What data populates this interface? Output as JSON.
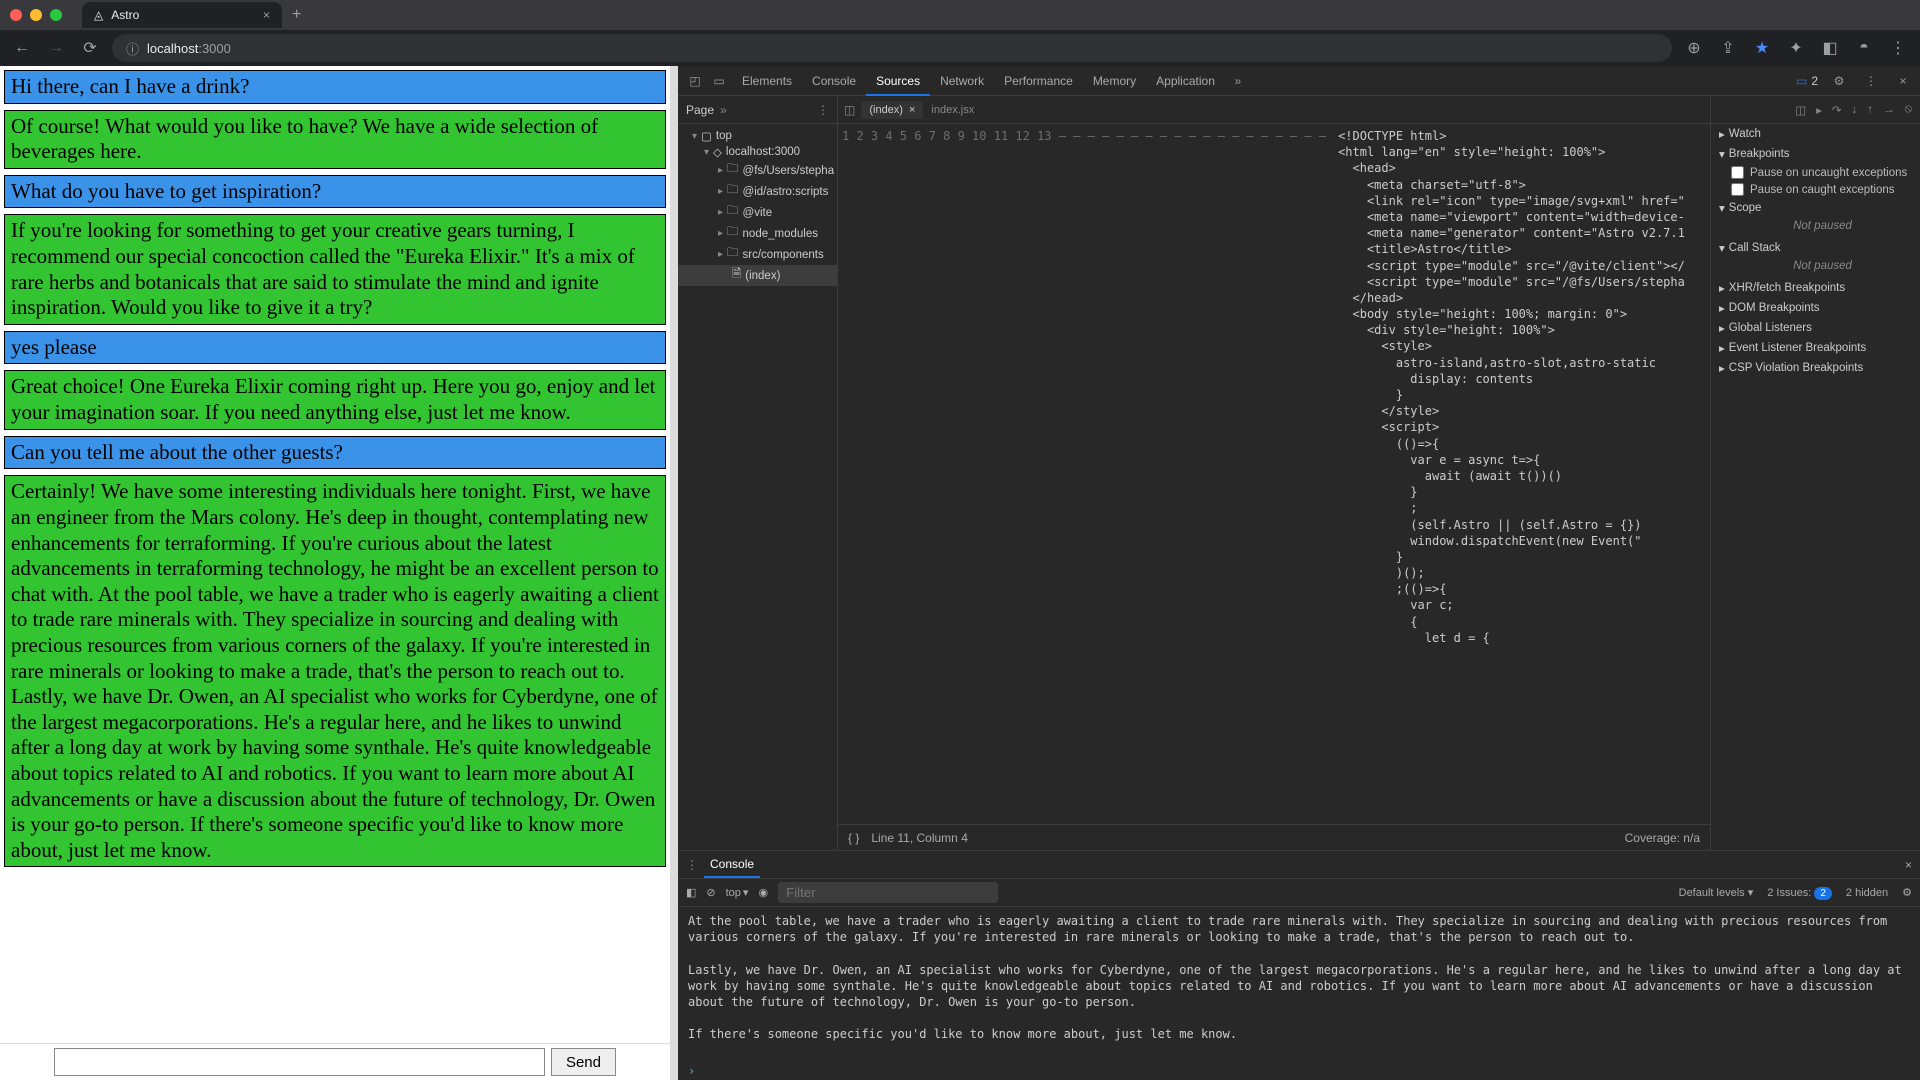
{
  "browser": {
    "tab_title": "Astro",
    "url_host": "localhost",
    "url_port": ":3000"
  },
  "chat": {
    "messages": [
      {
        "role": "user",
        "text": "Hi there, can I have a drink?"
      },
      {
        "role": "asst",
        "text": "Of course! What would you like to have? We have a wide selection of beverages here."
      },
      {
        "role": "user",
        "text": "What do you have to get inspiration?"
      },
      {
        "role": "asst",
        "text": "If you're looking for something to get your creative gears turning, I recommend our special concoction called the \"Eureka Elixir.\" It's a mix of rare herbs and botanicals that are said to stimulate the mind and ignite inspiration. Would you like to give it a try?"
      },
      {
        "role": "user",
        "text": "yes please"
      },
      {
        "role": "asst",
        "text": "Great choice! One Eureka Elixir coming right up. Here you go, enjoy and let your imagination soar. If you need anything else, just let me know."
      },
      {
        "role": "user",
        "text": "Can you tell me about the other guests?"
      },
      {
        "role": "asst",
        "text": "Certainly! We have some interesting individuals here tonight. First, we have an engineer from the Mars colony. He's deep in thought, contemplating new enhancements for terraforming. If you're curious about the latest advancements in terraforming technology, he might be an excellent person to chat with. At the pool table, we have a trader who is eagerly awaiting a client to trade rare minerals with. They specialize in sourcing and dealing with precious resources from various corners of the galaxy. If you're interested in rare minerals or looking to make a trade, that's the person to reach out to. Lastly, we have Dr. Owen, an AI specialist who works for Cyberdyne, one of the largest megacorporations. He's a regular here, and he likes to unwind after a long day at work by having some synthale. He's quite knowledgeable about topics related to AI and robotics. If you want to learn more about AI advancements or have a discussion about the future of technology, Dr. Owen is your go-to person. If there's someone specific you'd like to know more about, just let me know."
      }
    ],
    "send_label": "Send"
  },
  "devtools": {
    "tabs": [
      "Elements",
      "Console",
      "Sources",
      "Network",
      "Performance",
      "Memory",
      "Application"
    ],
    "active_tab": "Sources",
    "issues_count": "2",
    "page_label": "Page",
    "file_tree": {
      "top": "top",
      "host": "localhost:3000",
      "items": [
        "@fs/Users/stepha",
        "@id/astro:scripts",
        "@vite",
        "node_modules",
        "src/components"
      ],
      "file": "(index)"
    },
    "open_files": [
      "(index)",
      "index.jsx"
    ],
    "gutter": [
      "1",
      "2",
      "3",
      "4",
      "5",
      "6",
      "7",
      "8",
      "9",
      "10",
      "11",
      "12",
      "13",
      "–",
      "–",
      "–",
      "–",
      "–",
      "–",
      "–",
      "–",
      "–",
      "–",
      "–",
      "–",
      "–",
      "–",
      "–",
      "–",
      "–",
      "–",
      "–"
    ],
    "code_lines": [
      "<!DOCTYPE html>",
      "<html lang=\"en\" style=\"height: 100%\">",
      "  <head>",
      "    <meta charset=\"utf-8\">",
      "    <link rel=\"icon\" type=\"image/svg+xml\" href=\"",
      "    <meta name=\"viewport\" content=\"width=device-",
      "    <meta name=\"generator\" content=\"Astro v2.7.1",
      "    <title>Astro</title>",
      "    <script type=\"module\" src=\"/@vite/client\"></",
      "    <script type=\"module\" src=\"/@fs/Users/stepha",
      "  </head>",
      "  <body style=\"height: 100%; margin: 0\">",
      "    <div style=\"height: 100%\">",
      "      <style>",
      "        astro-island,astro-slot,astro-static",
      "          display: contents",
      "        }",
      "      </style>",
      "      <script>",
      "        (()=>{",
      "          var e = async t=>{",
      "            await (await t())()",
      "          }",
      "          ;",
      "          (self.Astro || (self.Astro = {})",
      "          window.dispatchEvent(new Event(\"",
      "        }",
      "        )();",
      "        ;(()=>{",
      "          var c;",
      "          {",
      "            let d = {"
    ],
    "status": {
      "line": "Line 11, Column 4",
      "coverage": "Coverage: n/a"
    },
    "right_panes": {
      "watch": "Watch",
      "breakpoints": "Breakpoints",
      "pause_uncaught": "Pause on uncaught exceptions",
      "pause_caught": "Pause on caught exceptions",
      "scope": "Scope",
      "not_paused": "Not paused",
      "callstack": "Call Stack",
      "xhr": "XHR/fetch Breakpoints",
      "dom": "DOM Breakpoints",
      "global": "Global Listeners",
      "event": "Event Listener Breakpoints",
      "csp": "CSP Violation Breakpoints"
    },
    "console": {
      "title": "Console",
      "context": "top",
      "filter_placeholder": "Filter",
      "levels": "Default levels",
      "issues_label": "2 Issues:",
      "issues_count": "2",
      "hidden": "2 hidden",
      "log": "At the pool table, we have a trader who is eagerly awaiting a client to trade rare minerals with. They specialize in sourcing and dealing with precious resources from various corners of the galaxy. If you're interested in rare minerals or looking to make a trade, that's the person to reach out to.\n\nLastly, we have Dr. Owen, an AI specialist who works for Cyberdyne, one of the largest megacorporations. He's a regular here, and he likes to unwind after a long day at work by having some synthale. He's quite knowledgeable about topics related to AI and robotics. If you want to learn more about AI advancements or have a discussion about the future of technology, Dr. Owen is your go-to person.\n\nIf there's someone specific you'd like to know more about, just let me know."
    }
  }
}
